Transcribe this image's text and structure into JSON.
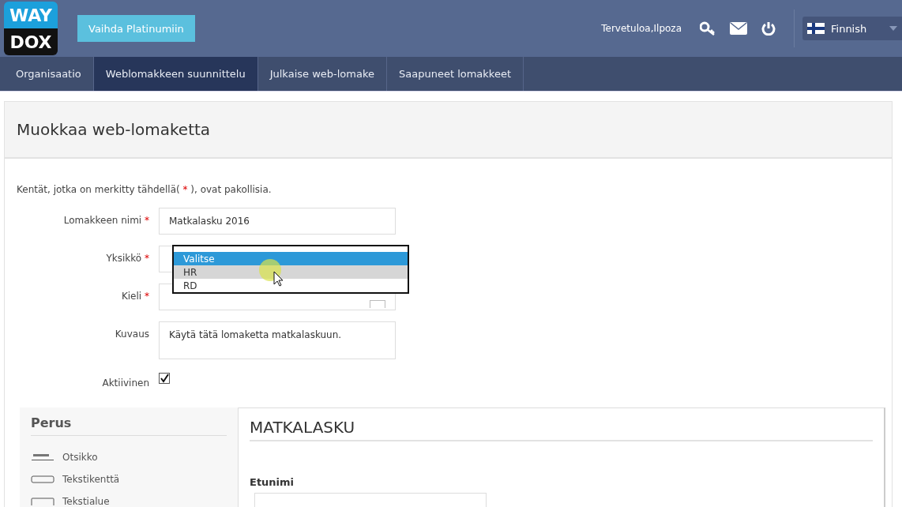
{
  "header": {
    "logo": {
      "line1": "WAY",
      "line2": "DOX"
    },
    "upgrade_button": "Vaihda Platinumiin",
    "welcome": "Tervetuloa,Ilpoza",
    "language": {
      "label": "Finnish"
    }
  },
  "nav": {
    "tabs": [
      {
        "label": "Organisaatio",
        "selected": false
      },
      {
        "label": "Weblomakkeen suunnittelu",
        "selected": true
      },
      {
        "label": "Julkaise web-lomake",
        "selected": false
      },
      {
        "label": "Saapuneet lomakkeet",
        "selected": false
      }
    ]
  },
  "page_title": "Muokkaa web-lomaketta",
  "required_note": {
    "before": "Kentät, jotka on merkitty tähdellä(",
    "mark": "*",
    "after": "), ovat pakollisia."
  },
  "fields": [
    {
      "kind": "text",
      "label": "Lomakkeen nimi",
      "required": true,
      "value": "Matkalasku 2016"
    },
    {
      "kind": "select",
      "label": "Yksikkö",
      "required": true,
      "open": true,
      "options": [
        {
          "label": "Valitse",
          "selected": true,
          "hovered": false
        },
        {
          "label": "HR",
          "selected": false,
          "hovered": true
        },
        {
          "label": "RD",
          "selected": false,
          "hovered": false
        }
      ]
    },
    {
      "kind": "select",
      "label": "Kieli",
      "required": true,
      "open": false
    },
    {
      "kind": "textarea",
      "label": "Kuvaus",
      "required": false,
      "value": "Käytä tätä lomaketta matkalaskuun."
    },
    {
      "kind": "checkbox",
      "label": "Aktiivinen",
      "required": false,
      "checked": true
    }
  ],
  "palette": {
    "title": "Perus",
    "items": [
      {
        "kind": "heading",
        "label": "Otsikko"
      },
      {
        "kind": "textfield",
        "label": "Tekstikenttä"
      },
      {
        "kind": "textarea",
        "label": "Tekstialue"
      }
    ]
  },
  "canvas": {
    "title": "MATKALASKU",
    "fields": [
      {
        "label": "Etunimi"
      }
    ]
  }
}
